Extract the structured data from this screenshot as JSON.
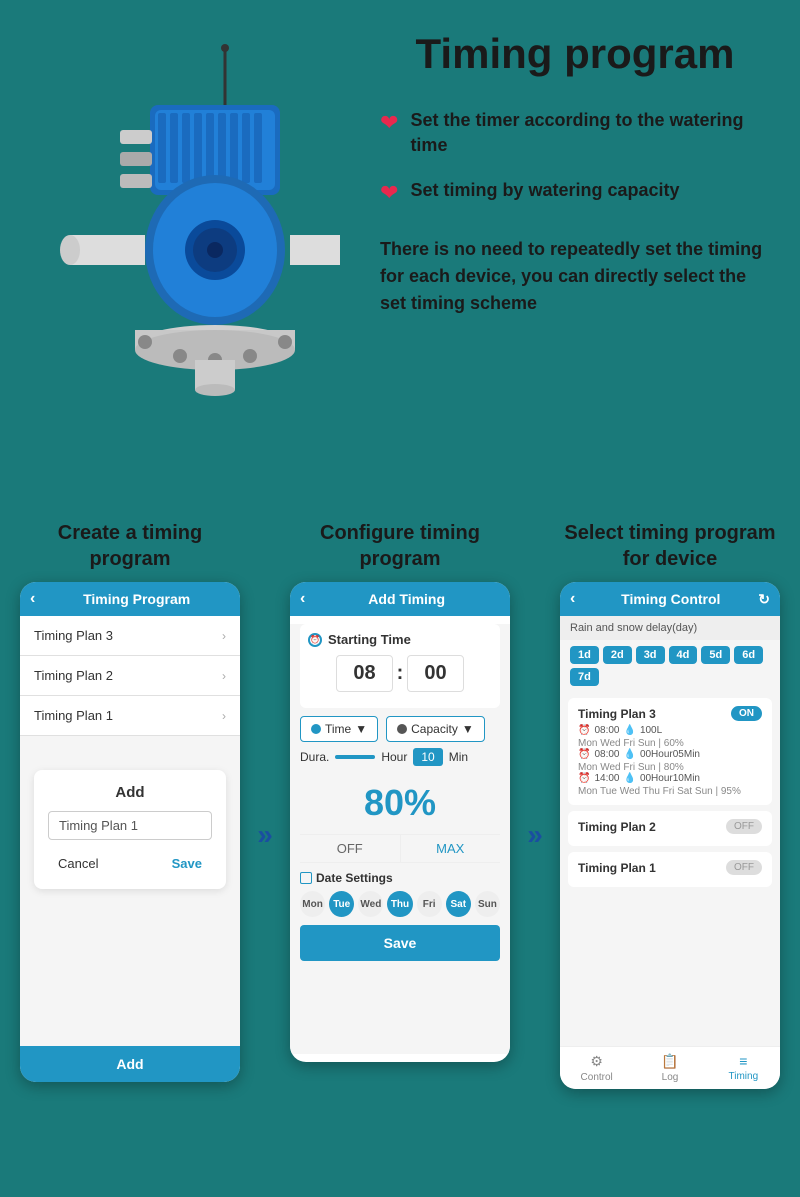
{
  "page": {
    "title": "Timing program",
    "background_color": "#1a7a7a"
  },
  "top": {
    "bullet1": "Set the timer according to the watering time",
    "bullet2": "Set timing by watering capacity",
    "description": "There is no need to repeatedly set the timing for each device, you can directly select the set timing scheme"
  },
  "steps": [
    {
      "title": "Create a timing program",
      "phone": {
        "header": "Timing Program",
        "plans": [
          "Timing Plan 3",
          "Timing Plan 2",
          "Timing Plan 1"
        ],
        "dialog_title": "Add",
        "dialog_input": "Timing Plan 1",
        "cancel_label": "Cancel",
        "save_label": "Save",
        "footer_label": "Add"
      }
    },
    {
      "title": "Configure timing program",
      "phone": {
        "header": "Add Timing",
        "starting_time_label": "Starting Time",
        "hour": "08",
        "minute": "00",
        "type1": "Time",
        "type2": "Capacity",
        "duration_label": "Dura.",
        "duration_value": "10",
        "hour_label": "Hour",
        "min_label": "Min",
        "percent": "80%",
        "off_label": "OFF",
        "max_label": "MAX",
        "date_label": "Date Settings",
        "days": [
          "Mon",
          "Tue",
          "Wed",
          "Thu",
          "Fri",
          "Sat",
          "Sun"
        ],
        "active_days": [
          "Tue",
          "Thu",
          "Sat"
        ],
        "save_label": "Save"
      }
    },
    {
      "title": "Select timing program for device",
      "phone": {
        "header": "Timing Control",
        "rain_delay": "Rain and snow delay(day)",
        "day_chips": [
          "1d",
          "2d",
          "3d",
          "4d",
          "5d",
          "6d",
          "7d"
        ],
        "plans": [
          {
            "name": "Timing Plan 3",
            "toggle": "ON",
            "schedules": [
              {
                "time": "08:00",
                "capacity": "100L",
                "days": "Mon Wed Fri Sun | 60%"
              },
              {
                "time": "08:00",
                "capacity": "00Hour05Min",
                "days": "Mon Wed Fri Sun | 80%"
              },
              {
                "time": "14:00",
                "capacity": "00Hour10Min",
                "days": "Mon Tue Wed Thu Fri Sat Sun | 95%"
              }
            ]
          },
          {
            "name": "Timing Plan 2",
            "toggle": "OFF",
            "schedules": []
          },
          {
            "name": "Timing Plan 1",
            "toggle": "OFF",
            "schedules": []
          }
        ],
        "nav": [
          "Control",
          "Log",
          "Timing"
        ],
        "active_nav": "Timing"
      }
    }
  ]
}
